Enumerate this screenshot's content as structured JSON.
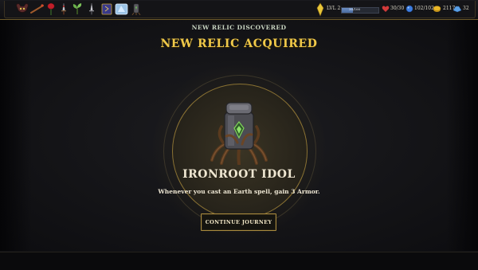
{
  "relic_bar": {
    "items": [
      {
        "icon": "horned-mask-relic-icon"
      },
      {
        "icon": "wooden-staff-relic-icon"
      },
      {
        "icon": "red-rose-relic-icon"
      },
      {
        "icon": "bloody-dagger-relic-icon"
      },
      {
        "icon": "sprout-relic-icon"
      },
      {
        "icon": "steel-dagger-relic-icon"
      },
      {
        "icon": "spellbook-relic-icon"
      },
      {
        "icon": "ice-crystal-relic-icon"
      },
      {
        "icon": "ironroot-idol-relic-icon"
      }
    ]
  },
  "player": {
    "level_label": "LVL 2",
    "xp_text": "30/100",
    "xp_fraction": 0.3,
    "health": "30/30",
    "mana": "102/102",
    "gold": "2117",
    "gems": "32",
    "colors": {
      "xp": "#5b7db5",
      "health": "#d23a3a",
      "mana": "#3f7fe0",
      "gold": "#e8b628",
      "gems": "#5aa0e6"
    }
  },
  "reward": {
    "subtitle": "NEW RELIC DISCOVERED",
    "title": "NEW RELIC ACQUIRED",
    "relic_name": "IRONROOT IDOL",
    "relic_description": "Whenever you cast an Earth spell, gain 3 Armor.",
    "relic_icon": "ironroot-idol-icon",
    "continue_label": "CONTINUE JOURNEY",
    "accent_color": "#f0c94a"
  }
}
